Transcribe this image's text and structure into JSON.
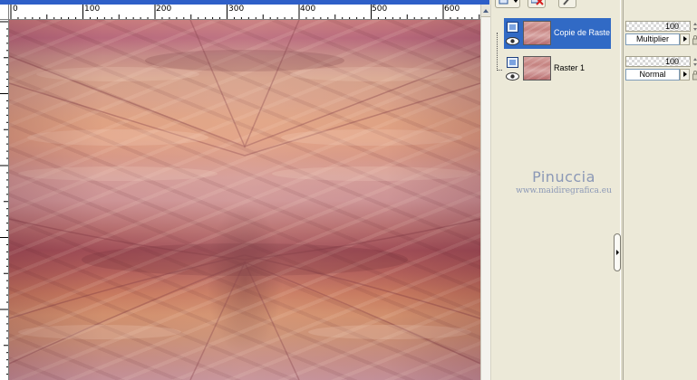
{
  "ruler": {
    "labels": [
      "0",
      "100",
      "200",
      "300",
      "400",
      "500",
      "600"
    ]
  },
  "layers": [
    {
      "name": "Copie de Raste",
      "selected": true
    },
    {
      "name": "Raster 1",
      "selected": false
    }
  ],
  "properties": [
    {
      "opacity": "100",
      "blend_mode": "Multiplier"
    },
    {
      "opacity": "100",
      "blend_mode": "Normal"
    }
  ],
  "watermark": {
    "title": "Pinuccia",
    "url": "www.maidiregrafica.eu"
  },
  "colors": {
    "selection": "#316ac5",
    "panel_background": "#ece9d8",
    "title_bar": "#2e5fc8",
    "watermark": "#8b98b6"
  },
  "icons": {
    "toolbar": [
      "new-layer-icon",
      "delete-layer-icon",
      "paint-brush-icon"
    ],
    "layer_row": [
      "raster-group-icon",
      "visibility-eye-icon"
    ],
    "properties": [
      "lock-icon"
    ]
  }
}
